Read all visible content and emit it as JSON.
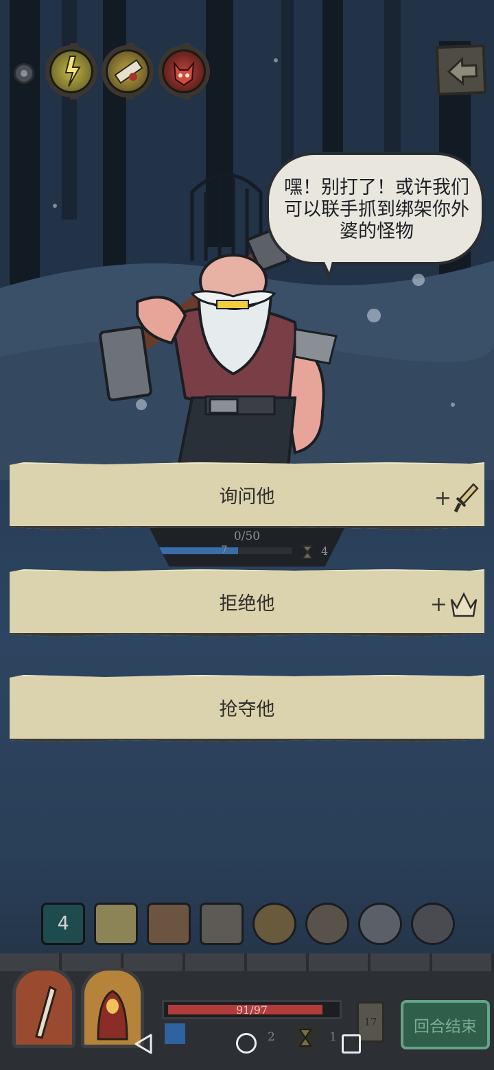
{
  "speech": {
    "text": "嘿！别打了！或许我们可以联手抓到绑架你外婆的怪物"
  },
  "options": [
    {
      "label": "询问他",
      "reward_icon": "sword-icon",
      "reward_prefix": "+"
    },
    {
      "label": "拒绝他",
      "reward_icon": "crown-icon",
      "reward_prefix": "+"
    },
    {
      "label": "抢夺他",
      "reward_icon": "",
      "reward_prefix": ""
    }
  ],
  "progress": {
    "text": "0/50",
    "bar_value": "7",
    "fill_fraction": 0.6,
    "turns": "4"
  },
  "deck": {
    "active_count": "4",
    "icons": [
      "card-pile-icon",
      "map-card-icon",
      "chest-card-icon",
      "anvil-card-icon",
      "mount-card-icon",
      "skull-token-icon",
      "army-token-icon",
      "boot-token-icon"
    ]
  },
  "player": {
    "hp_text": "91/97",
    "hp_fraction": 0.938,
    "mana": "2",
    "time": "1",
    "deck_count": "17"
  },
  "end_turn_label": "回合结束",
  "colors": {
    "card_bg": "#dbd3ad",
    "hp": "#b23b3b",
    "mana": "#2e62a0",
    "end_turn": "#2f5f4a"
  }
}
